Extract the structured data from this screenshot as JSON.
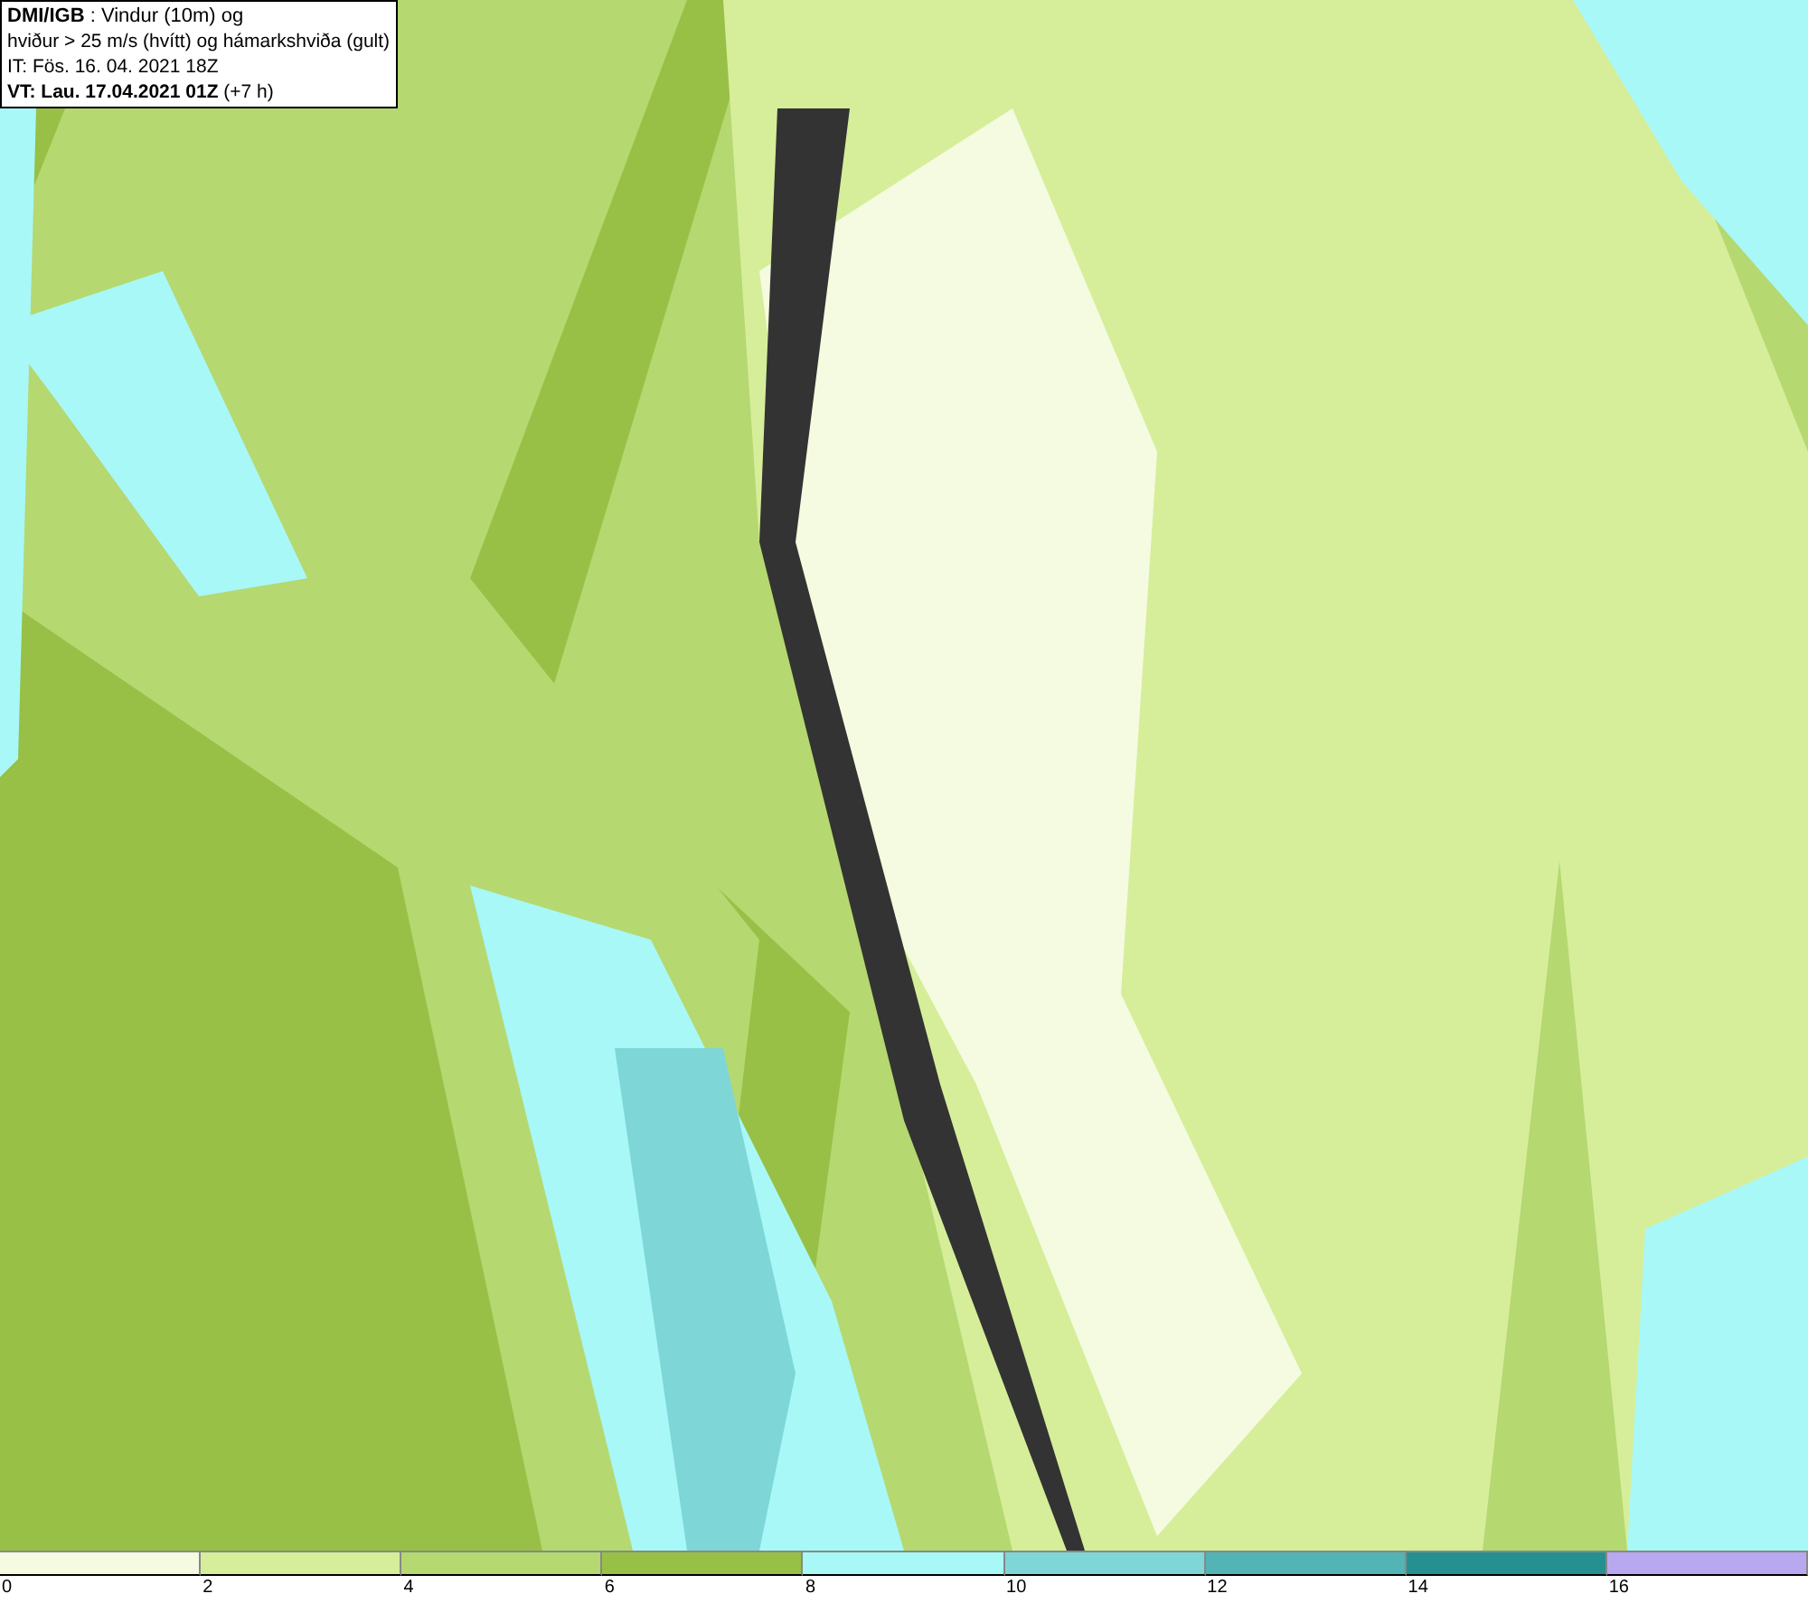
{
  "title_box": {
    "lines": [
      "**DMI/IGB** : Vindur (10m) og",
      "hviður > 25 m/s (hvítt) og hámarkshviða (gult)",
      "IT: Fös. 16. 04. 2021 18Z",
      "**VT: Lau. 17.04.2021 01Z** (+7 h)"
    ]
  },
  "legend": [
    {
      "label": "0",
      "color": "#f5fbe0"
    },
    {
      "label": "2",
      "color": "#d6ee9a"
    },
    {
      "label": "4",
      "color": "#b5d870"
    },
    {
      "label": "6",
      "color": "#98c046"
    },
    {
      "label": "8",
      "color": "#a8f8f8"
    },
    {
      "label": "10",
      "color": "#7ed6d6"
    },
    {
      "label": "12",
      "color": "#52b4b4"
    },
    {
      "label": "14",
      "color": "#259090"
    },
    {
      "label": "16",
      "color": "#b8a8f0"
    }
  ]
}
